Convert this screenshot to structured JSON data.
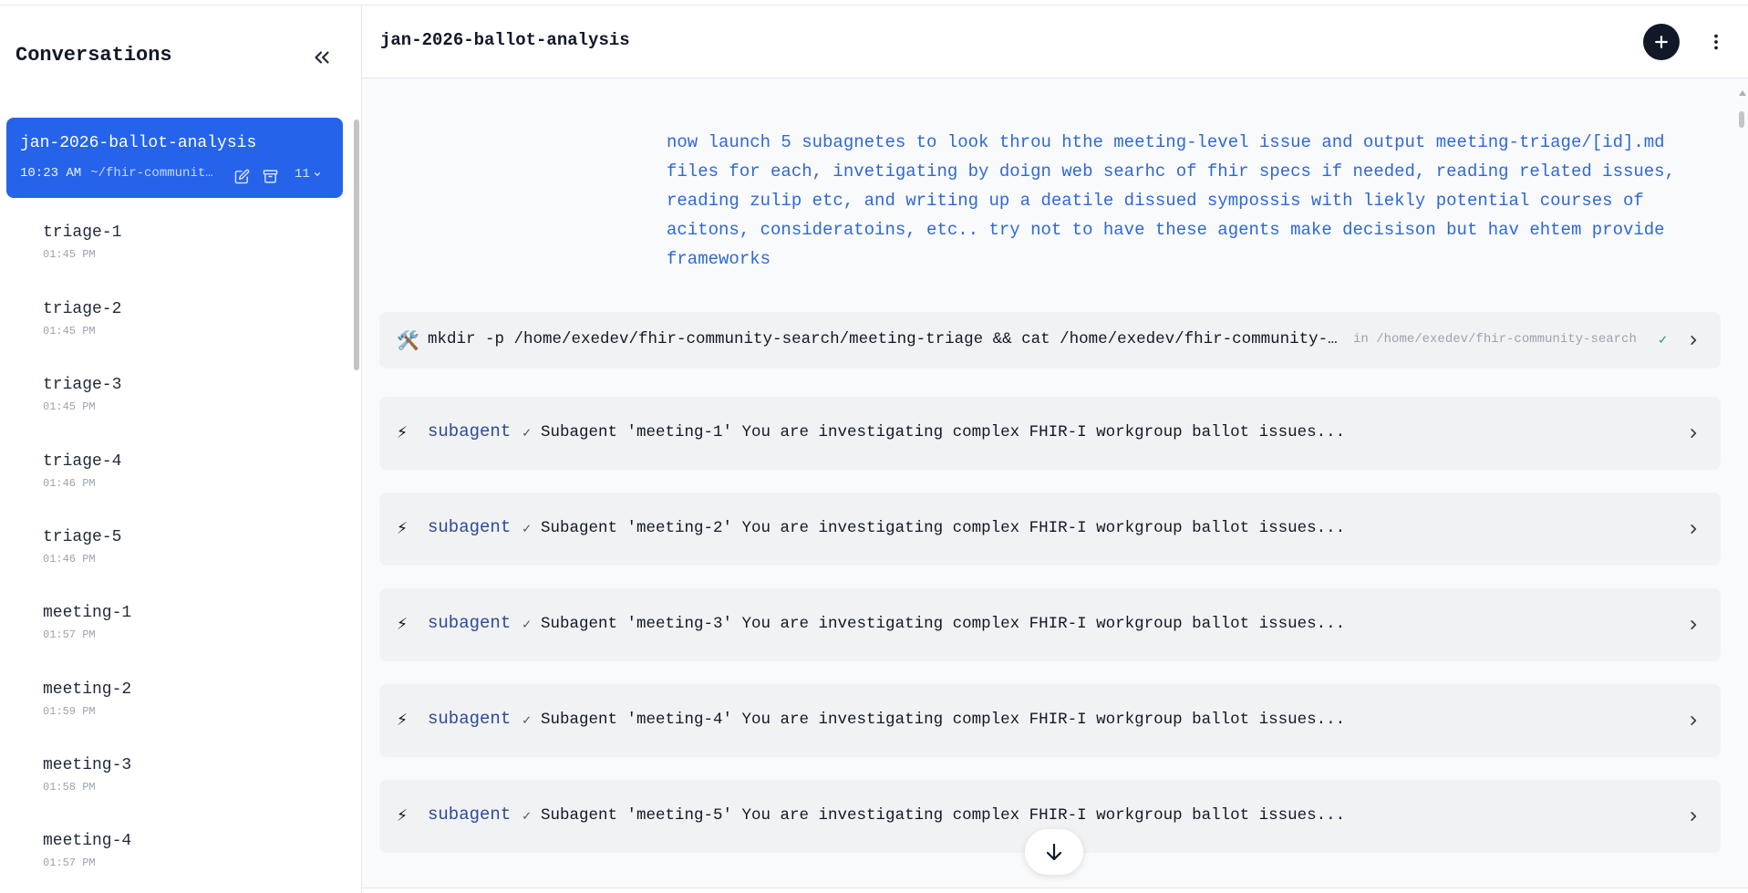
{
  "sidebar": {
    "title": "Conversations",
    "active": {
      "name": "jan-2026-ballot-analysis",
      "time": "10:23 AM",
      "path": "~/fhir-community-search",
      "count": "11"
    },
    "items": [
      {
        "name": "triage-1",
        "time": "01:45 PM"
      },
      {
        "name": "triage-2",
        "time": "01:45 PM"
      },
      {
        "name": "triage-3",
        "time": "01:45 PM"
      },
      {
        "name": "triage-4",
        "time": "01:46 PM"
      },
      {
        "name": "triage-5",
        "time": "01:46 PM"
      },
      {
        "name": "meeting-1",
        "time": "01:57 PM"
      },
      {
        "name": "meeting-2",
        "time": "01:59 PM"
      },
      {
        "name": "meeting-3",
        "time": "01:58 PM"
      },
      {
        "name": "meeting-4",
        "time": "01:57 PM"
      }
    ]
  },
  "main": {
    "title": "jan-2026-ballot-analysis",
    "user_message": "now launch 5 subagnetes to look throu hthe meeting-level issue and output meeting-triage/[id].md files for each, invetigating by doign web searhc of fhir specs if needed, reading related issues, reading zulip etc, and writing up a deatile dissued sympossis with liekly potential courses of acitons, consideratoins, etc.. try not to have these agents make decisison but hav ehtem provide frameworks",
    "bash": {
      "icon": "🛠️",
      "command": "mkdir -p /home/exedev/fhir-community-search/meeting-triage && cat /home/exedev/fhir-community-search/meeting-triage/README.md",
      "cwd": "in /home/exedev/fhir-community-search",
      "check": "✓"
    },
    "subagents": [
      {
        "icon": "⚡",
        "tool": "subagent",
        "check": "✓",
        "desc": "Subagent 'meeting-1' You are investigating complex FHIR-I workgroup ballot issues..."
      },
      {
        "icon": "⚡",
        "tool": "subagent",
        "check": "✓",
        "desc": "Subagent 'meeting-2' You are investigating complex FHIR-I workgroup ballot issues..."
      },
      {
        "icon": "⚡",
        "tool": "subagent",
        "check": "✓",
        "desc": "Subagent 'meeting-3' You are investigating complex FHIR-I workgroup ballot issues..."
      },
      {
        "icon": "⚡",
        "tool": "subagent",
        "check": "✓",
        "desc": "Subagent 'meeting-4' You are investigating complex FHIR-I workgroup ballot issues..."
      },
      {
        "icon": "⚡",
        "tool": "subagent",
        "check": "✓",
        "desc": "Subagent 'meeting-5' You are investigating complex FHIR-I workgroup ballot issues..."
      }
    ]
  },
  "colors": {
    "accent": "#2563eb",
    "user_text": "#2f68d6",
    "tool_name": "#2b4a9b"
  },
  "icons": {
    "collapse": "chevrons-left-icon",
    "edit": "edit-icon",
    "archive": "archive-icon",
    "count_dropdown": "chevron-down-icon",
    "new": "plus-icon",
    "more": "more-vertical-icon",
    "row_expand": "chevron-right-icon",
    "scroll_down": "arrow-down-icon"
  }
}
